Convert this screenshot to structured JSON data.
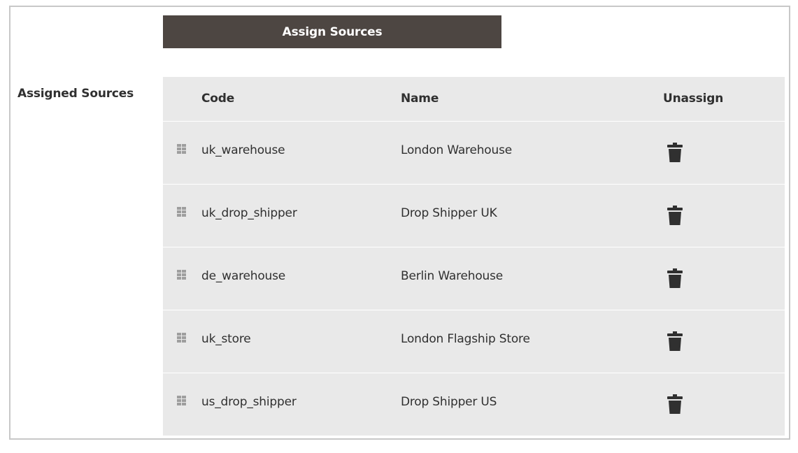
{
  "assign_button": {
    "label": "Assign Sources"
  },
  "field_label": "Assigned Sources",
  "table": {
    "columns": [
      "Code",
      "Name",
      "Unassign"
    ],
    "rows": [
      {
        "code": "uk_warehouse",
        "name": "London Warehouse"
      },
      {
        "code": "uk_drop_shipper",
        "name": "Drop Shipper UK"
      },
      {
        "code": "de_warehouse",
        "name": "Berlin Warehouse"
      },
      {
        "code": "uk_store",
        "name": "London Flagship Store"
      },
      {
        "code": "us_drop_shipper",
        "name": "Drop Shipper US"
      }
    ]
  },
  "icons": {
    "drag": "drag-handle-icon",
    "unassign": "trash-icon"
  },
  "colors": {
    "button_bg": "#4d4642",
    "table_bg": "#e9e9e9",
    "text": "#303030"
  }
}
